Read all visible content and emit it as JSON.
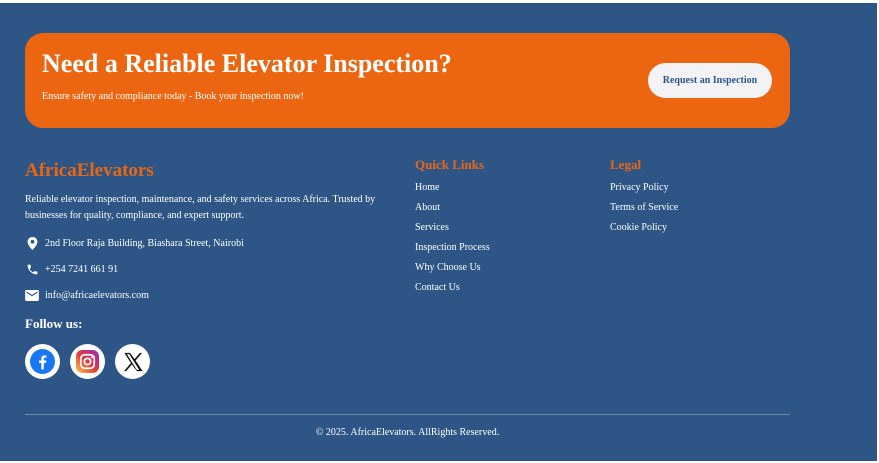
{
  "cta": {
    "title": "Need a Reliable Elevator Inspection?",
    "subtitle": "Ensure safety and compliance today - Book your inspection now!",
    "button_label": "Request an Inspection"
  },
  "brand": {
    "name": "AfricaElevators",
    "description": "Reliable elevator inspection, maintenance, and safety services across Africa. Trusted by businesses for quality, compliance, and expert support."
  },
  "contact": {
    "address": "2nd Floor Raja Building, Biashara Street, Nairobi",
    "phone": "+254 7241 661 91",
    "email": "info@africaelevators.com"
  },
  "social": {
    "title": "Follow us:",
    "items": [
      "facebook-icon",
      "instagram-icon",
      "x-icon"
    ]
  },
  "quick_links": {
    "title": "Quick Links",
    "items": [
      "Home",
      "About",
      "Services",
      "Inspection Process",
      "Why Choose Us",
      "Contact Us"
    ]
  },
  "legal": {
    "title": "Legal",
    "items": [
      "Privacy Policy",
      "Terms of Service",
      "Cookie Policy"
    ]
  },
  "copyright": "© 2025. AfricaElevators. AllRights Reserved.",
  "colors": {
    "background": "#2d5686",
    "accent": "#ec6611",
    "button_bg": "#f3f3f5"
  }
}
